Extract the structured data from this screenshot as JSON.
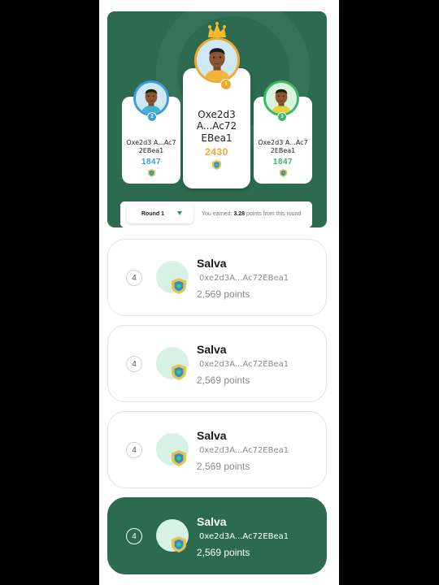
{
  "podium": {
    "first": {
      "rank": "1",
      "name": "Oxe2d3 A...Ac72 EBea1",
      "score": "2430"
    },
    "second": {
      "rank": "2",
      "name": "Oxe2d3 A...Ac7 2EBea1",
      "score": "1847"
    },
    "third": {
      "rank": "3",
      "name": "Oxe2d3 A...Ac7 2EBea1",
      "score": "1847"
    }
  },
  "round_bar": {
    "selected_round": "Round 1",
    "earned_prefix": "You earned:",
    "earned_points": "3.28",
    "earned_suffix": "points from this round"
  },
  "entries": [
    {
      "rank": "4",
      "name": "Salva",
      "address": "0xe2d3A...Ac72EBea1",
      "points": "2,569 points",
      "highlighted": false
    },
    {
      "rank": "4",
      "name": "Salva",
      "address": "0xe2d3A...Ac72EBea1",
      "points": "2,569 points",
      "highlighted": false
    },
    {
      "rank": "4",
      "name": "Salva",
      "address": "0xe2d3A...Ac72EBea1",
      "points": "2,569 points",
      "highlighted": false
    },
    {
      "rank": "4",
      "name": "Salva",
      "address": "0xe2d3A...Ac72EBea1",
      "points": "2,569 points",
      "highlighted": true
    }
  ],
  "colors": {
    "brand_green": "#2c6b50",
    "gold": "#f0a830",
    "silver_blue": "#3d9be0",
    "bronze_green": "#38b865"
  },
  "icons": {
    "crown": "crown-icon",
    "rank_shield": "shield-icon",
    "dropdown": "caret-down-icon"
  }
}
